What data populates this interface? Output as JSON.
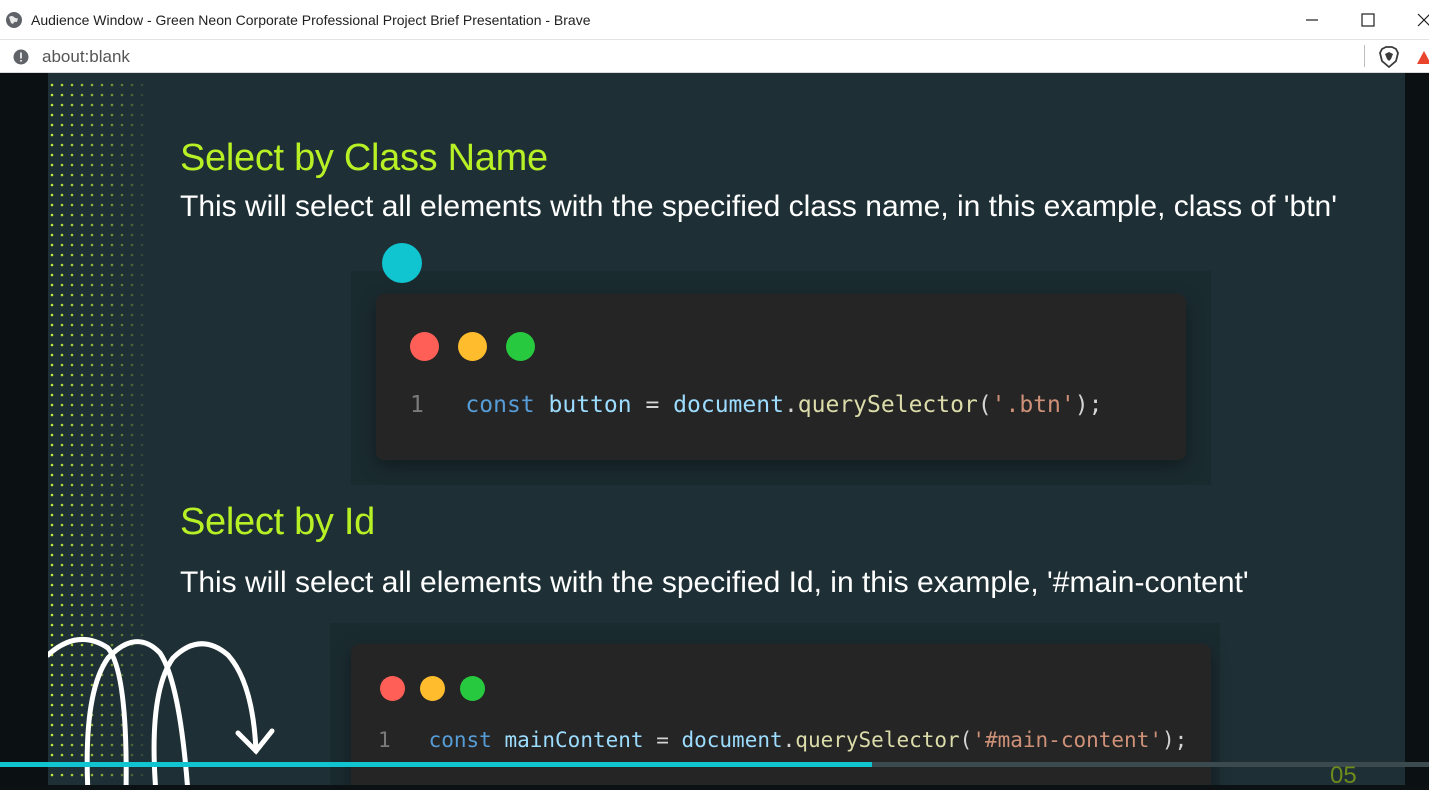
{
  "window": {
    "title": "Audience Window - Green Neon Corporate Professional Project Brief Presentation - Brave"
  },
  "addressbar": {
    "url": "about:blank"
  },
  "slide": {
    "section1": {
      "heading": "Select by Class Name",
      "text": "This will select all elements with the specified class name, in this example, class of 'btn'",
      "code": {
        "line_number": "1",
        "keyword": "const",
        "variable": "button",
        "equals": " = ",
        "object": "document",
        "dot": ".",
        "method": "querySelector",
        "open": "(",
        "argument": "'.btn'",
        "close": ");"
      }
    },
    "section2": {
      "heading": "Select by Id",
      "text": "This will select all elements with the specified Id, in this example, '#main-content'",
      "code": {
        "line_number": "1",
        "keyword": "const",
        "variable": "mainContent",
        "equals": " = ",
        "object": "document",
        "dot": ".",
        "method": "querySelector",
        "open": "(",
        "argument": "'#main-content'",
        "close": ");"
      }
    },
    "page_number": "05",
    "progress": 0.61
  },
  "colors": {
    "accent_green": "#b7f025",
    "slide_bg": "#1e3035",
    "cursor_cyan": "#10c4d0",
    "code_bg": "#252525"
  },
  "icons": {
    "globe": "globe-icon",
    "info": "info-icon",
    "brave": "brave-lion-icon",
    "warning": "warning-triangle-icon"
  }
}
